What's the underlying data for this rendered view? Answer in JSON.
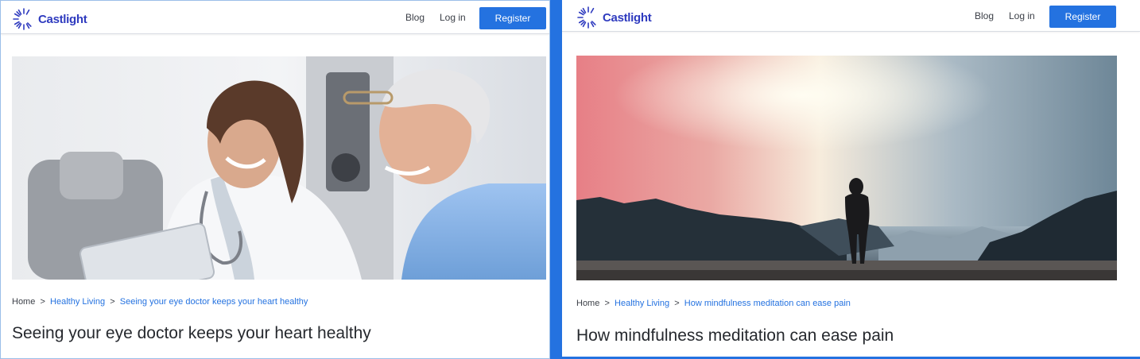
{
  "colors": {
    "brand": "#2f3bbf",
    "accent": "#2472e0",
    "link": "#2472e0",
    "text": "#26292e"
  },
  "left": {
    "logo_text": "Castlight",
    "nav": {
      "blog": "Blog",
      "login": "Log in",
      "register": "Register"
    },
    "hero_icon": "photo-doctor-patient-tablet",
    "breadcrumb": {
      "home": "Home",
      "sep1": ">",
      "category": "Healthy Living",
      "sep2": ">",
      "current": "Seeing your eye doctor keeps your heart healthy"
    },
    "title": "Seeing your eye doctor keeps your heart healthy"
  },
  "right": {
    "logo_text": "Castlight",
    "nav": {
      "blog": "Blog",
      "login": "Log in",
      "register": "Register"
    },
    "hero_icon": "photo-woman-lake-sunrise",
    "breadcrumb": {
      "home": "Home",
      "sep1": ">",
      "category": "Healthy Living",
      "sep2": ">",
      "current": "How mindfulness meditation can ease pain"
    },
    "title": "How mindfulness meditation can ease pain"
  }
}
